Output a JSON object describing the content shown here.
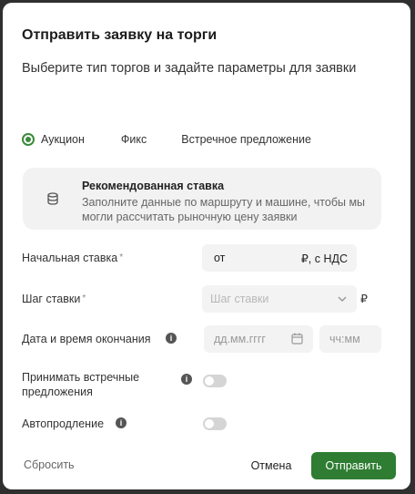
{
  "dialog": {
    "title": "Отправить заявку на торги",
    "subtitle": "Выберите тип торгов и задайте параметры для заявки"
  },
  "trade_type": {
    "options": [
      "Аукцион",
      "Фикс",
      "Встречное предложение"
    ],
    "selected": "Аукцион"
  },
  "hint": {
    "icon": "database-icon",
    "title": "Рекомендованная ставка",
    "text": "Заполните данные по маршруту и машине, чтобы мы могли рассчитать рыночную цену заявки"
  },
  "form": {
    "start_bid": {
      "label": "Начальная ставка",
      "required_mark": "*",
      "prefix": "от",
      "suffix": "₽, с НДС"
    },
    "bid_step": {
      "label": "Шаг ставки",
      "required_mark": "*",
      "placeholder": "Шаг ставки",
      "currency": "₽"
    },
    "end_datetime": {
      "label": "Дата и время окончания",
      "date_placeholder": "дд.мм.гггг",
      "time_placeholder": "чч:мм"
    },
    "accept_counter": {
      "label": "Принимать встречные предложения",
      "enabled": false
    },
    "auto_extend": {
      "label": "Автопродление",
      "enabled": false
    }
  },
  "footer": {
    "reset_label": "Сбросить",
    "cancel_label": "Отмена",
    "submit_label": "Отправить"
  },
  "colors": {
    "accent": "#2e7d32",
    "radio": "#3a8a3a"
  }
}
